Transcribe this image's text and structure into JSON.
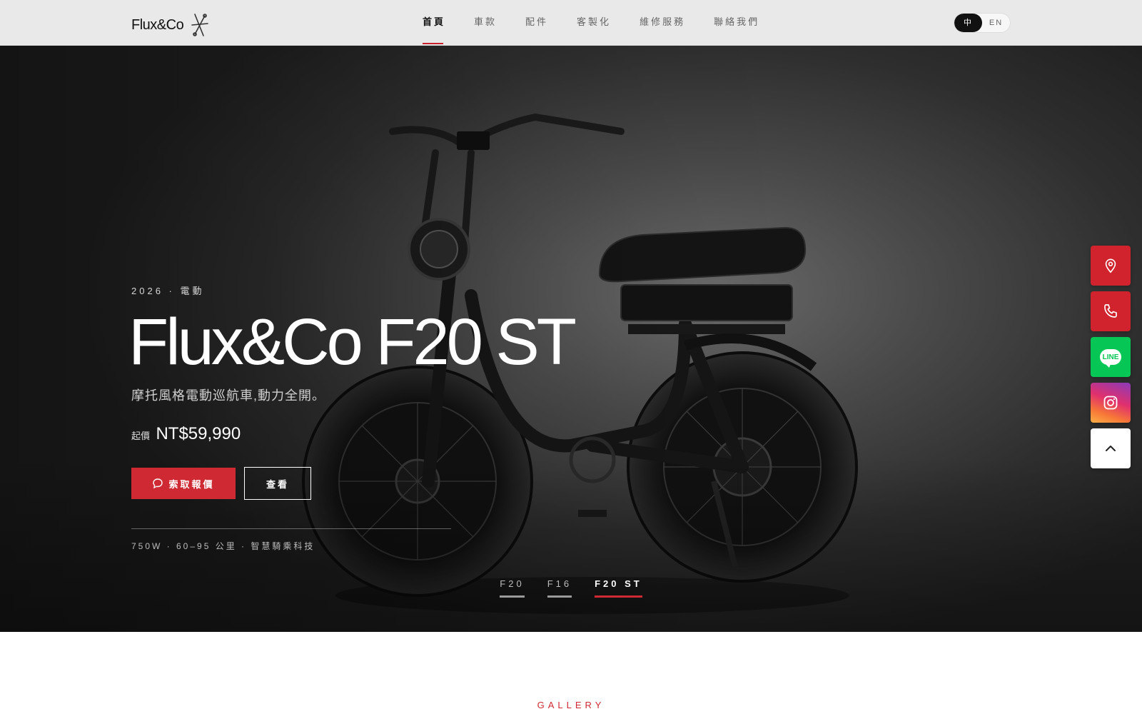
{
  "brand": {
    "name": "Flux&Co"
  },
  "nav": {
    "items": [
      {
        "label": "首頁",
        "active": true
      },
      {
        "label": "車款",
        "active": false
      },
      {
        "label": "配件",
        "active": false
      },
      {
        "label": "客製化",
        "active": false
      },
      {
        "label": "維修服務",
        "active": false
      },
      {
        "label": "聯絡我們",
        "active": false
      }
    ]
  },
  "lang": {
    "zh": "中",
    "en": "EN",
    "selected": "中"
  },
  "hero": {
    "eyebrow": "2026 · 電動",
    "title": "Flux&Co F20 ST",
    "subtitle": "摩托風格電動巡航車,動力全開。",
    "price_label": "起價",
    "price_value": "NT$59,990",
    "cta_quote": "索取報價",
    "cta_view": "查看",
    "specs": "750W · 60–95 公里 · 智慧騎乘科技",
    "slides": [
      {
        "label": "F20",
        "active": false
      },
      {
        "label": "F16",
        "active": false
      },
      {
        "label": "F20 ST",
        "active": true
      }
    ]
  },
  "float_buttons": {
    "line_label": "LINE",
    "icons": [
      "map-pin-icon",
      "phone-icon",
      "line-icon",
      "instagram-icon",
      "chevron-up-icon"
    ]
  },
  "gallery": {
    "label": "GALLERY"
  },
  "colors": {
    "accent": "#cf2a33",
    "line": "#06c755",
    "dark": "#111111"
  }
}
